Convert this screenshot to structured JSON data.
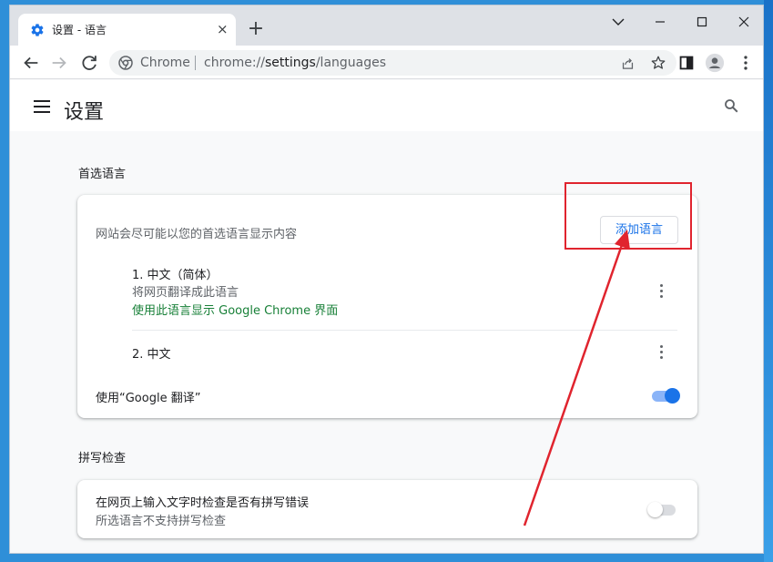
{
  "tab": {
    "title": "设置 - 语言",
    "close": "×",
    "new_tab": "+"
  },
  "omnibox": {
    "site": "Chrome",
    "url_scheme": "chrome://",
    "url_host": "settings",
    "url_path": "/languages"
  },
  "page": {
    "title": "设置"
  },
  "preferred": {
    "section_title": "首选语言",
    "description": "网站会尽可能以您的首选语言显示内容",
    "add_button": "添加语言",
    "languages": [
      {
        "name": "1. 中文（简体）",
        "line2": "将网页翻译成此语言",
        "line3": "使用此语言显示 Google Chrome 界面"
      },
      {
        "name": "2. 中文"
      }
    ],
    "translate_label": "使用“Google 翻译”",
    "translate_enabled": true
  },
  "spell": {
    "section_title": "拼写检查",
    "label": "在网页上输入文字时检查是否有拼写错误",
    "sublabel": "所选语言不支持拼写检查",
    "enabled": false
  },
  "colors": {
    "accent": "#1a73e8",
    "green_text": "#188038",
    "annotation": "#e0242e"
  }
}
